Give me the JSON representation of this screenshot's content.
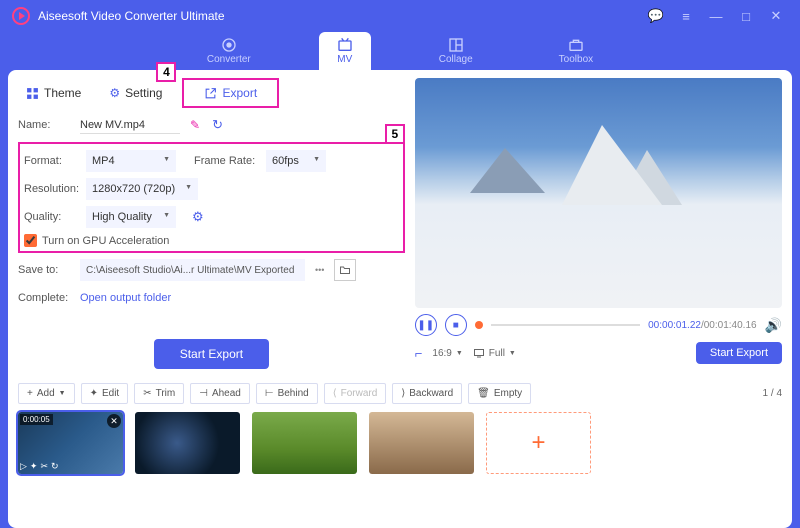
{
  "app": {
    "title": "Aiseesoft Video Converter Ultimate"
  },
  "topnav": {
    "converter": "Converter",
    "mv": "MV",
    "collage": "Collage",
    "toolbox": "Toolbox"
  },
  "tabs": {
    "theme": "Theme",
    "setting": "Setting",
    "export": "Export"
  },
  "callouts": {
    "c4": "4",
    "c5": "5"
  },
  "fields": {
    "name_label": "Name:",
    "name_value": "New MV.mp4",
    "format_label": "Format:",
    "format_value": "MP4",
    "framerate_label": "Frame Rate:",
    "framerate_value": "60fps",
    "resolution_label": "Resolution:",
    "resolution_value": "1280x720 (720p)",
    "quality_label": "Quality:",
    "quality_value": "High Quality",
    "gpu_label": "Turn on GPU Acceleration",
    "saveto_label": "Save to:",
    "saveto_value": "C:\\Aiseesoft Studio\\Ai...r Ultimate\\MV Exported",
    "complete_label": "Complete:",
    "complete_value": "Open output folder"
  },
  "buttons": {
    "start_export": "Start Export",
    "start_export2": "Start Export"
  },
  "player": {
    "time_current": "00:00:01.22",
    "time_total": "00:01:40.16",
    "aspect": "16:9",
    "fullscreen": "Full",
    "crop_icon": "⌐"
  },
  "toolbar": {
    "add": "Add",
    "edit": "Edit",
    "trim": "Trim",
    "ahead": "Ahead",
    "behind": "Behind",
    "forward": "Forward",
    "backward": "Backward",
    "empty": "Empty",
    "page_current": "1",
    "page_total": "4"
  },
  "thumbs": {
    "t1_duration": "0:00:05"
  }
}
